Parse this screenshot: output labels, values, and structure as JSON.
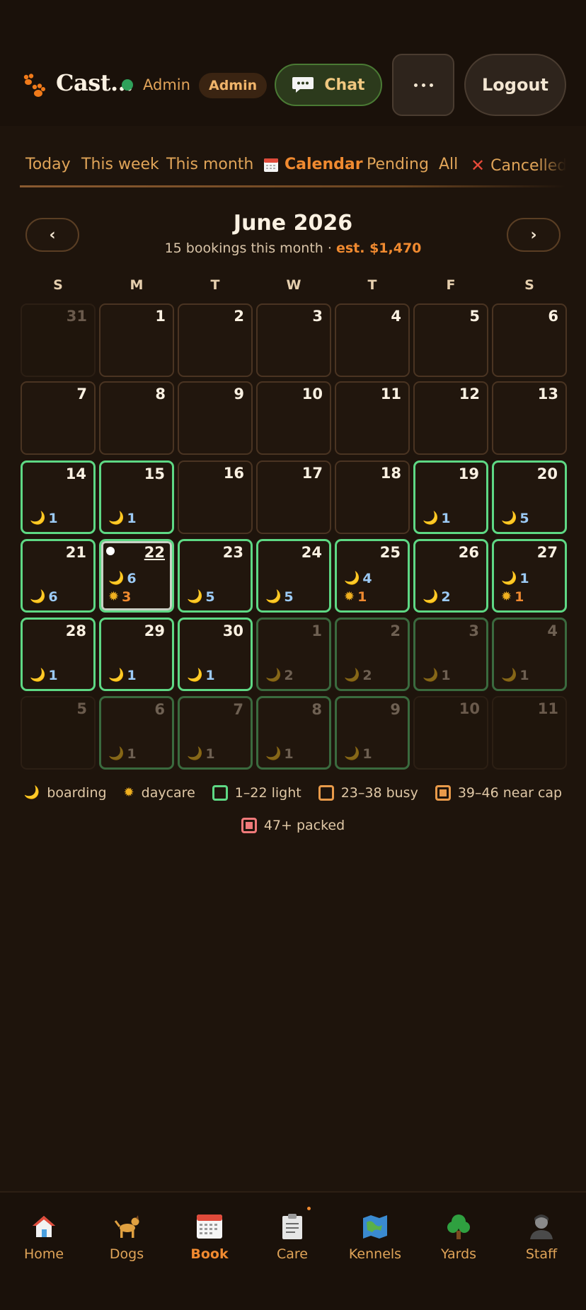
{
  "header": {
    "brand": "Cast...",
    "role_text": "Admin",
    "role_badge": "Admin",
    "chat_label": "Chat",
    "logout_label": "Logout"
  },
  "tabs": [
    {
      "label": "Today"
    },
    {
      "label": "This week"
    },
    {
      "label": "This month"
    },
    {
      "label": "Calendar",
      "active": true
    },
    {
      "label": "Pending"
    },
    {
      "label": "All"
    },
    {
      "label": "Cancelled"
    }
  ],
  "calendar": {
    "title": "June 2026",
    "subtitle": "15 bookings this month",
    "separator": "·",
    "estimate": "est. $1,470",
    "prev_label": "‹",
    "next_label": "›",
    "weekdays": [
      "S",
      "M",
      "T",
      "W",
      "T",
      "F",
      "S"
    ],
    "weeks": [
      [
        {
          "day": "31",
          "state": "outside"
        },
        {
          "day": "1",
          "state": "normal"
        },
        {
          "day": "2",
          "state": "normal"
        },
        {
          "day": "3",
          "state": "normal"
        },
        {
          "day": "4",
          "state": "normal"
        },
        {
          "day": "5",
          "state": "normal"
        },
        {
          "day": "6",
          "state": "normal"
        }
      ],
      [
        {
          "day": "7",
          "state": "normal"
        },
        {
          "day": "8",
          "state": "normal"
        },
        {
          "day": "9",
          "state": "normal"
        },
        {
          "day": "10",
          "state": "normal"
        },
        {
          "day": "11",
          "state": "normal"
        },
        {
          "day": "12",
          "state": "normal"
        },
        {
          "day": "13",
          "state": "normal"
        }
      ],
      [
        {
          "day": "14",
          "state": "light",
          "boarding": "1"
        },
        {
          "day": "15",
          "state": "light",
          "boarding": "1"
        },
        {
          "day": "16",
          "state": "normal"
        },
        {
          "day": "17",
          "state": "normal"
        },
        {
          "day": "18",
          "state": "normal"
        },
        {
          "day": "19",
          "state": "light",
          "boarding": "1"
        },
        {
          "day": "20",
          "state": "light",
          "boarding": "5"
        }
      ],
      [
        {
          "day": "21",
          "state": "light",
          "boarding": "6"
        },
        {
          "day": "22",
          "state": "today",
          "boarding": "6",
          "daycare": "3"
        },
        {
          "day": "23",
          "state": "light",
          "boarding": "5"
        },
        {
          "day": "24",
          "state": "light",
          "boarding": "5"
        },
        {
          "day": "25",
          "state": "light",
          "boarding": "4",
          "daycare": "1"
        },
        {
          "day": "26",
          "state": "light",
          "boarding": "2"
        },
        {
          "day": "27",
          "state": "light",
          "boarding": "1",
          "daycare": "1"
        }
      ],
      [
        {
          "day": "28",
          "state": "light",
          "boarding": "1"
        },
        {
          "day": "29",
          "state": "light",
          "boarding": "1"
        },
        {
          "day": "30",
          "state": "light",
          "boarding": "1"
        },
        {
          "day": "1",
          "state": "light-dim",
          "boarding": "2"
        },
        {
          "day": "2",
          "state": "light-dim",
          "boarding": "2"
        },
        {
          "day": "3",
          "state": "light-dim",
          "boarding": "1"
        },
        {
          "day": "4",
          "state": "light-dim",
          "boarding": "1"
        }
      ],
      [
        {
          "day": "5",
          "state": "outside"
        },
        {
          "day": "6",
          "state": "light-dim",
          "boarding": "1"
        },
        {
          "day": "7",
          "state": "light-dim",
          "boarding": "1"
        },
        {
          "day": "8",
          "state": "light-dim",
          "boarding": "1"
        },
        {
          "day": "9",
          "state": "light-dim",
          "boarding": "1"
        },
        {
          "day": "10",
          "state": "outside"
        },
        {
          "day": "11",
          "state": "outside"
        }
      ]
    ]
  },
  "legend": {
    "boarding": "boarding",
    "daycare": "daycare",
    "light": "1–22 light",
    "busy": "23–38 busy",
    "near_cap": "39–46 near cap",
    "packed": "47+ packed"
  },
  "colors": {
    "accent": "#f08a30",
    "light": "#5ed884",
    "busy": "#e89a4a",
    "packed": "#f07a7a",
    "boarding_count": "#9ccaf5"
  },
  "bottom_nav": [
    {
      "label": "Home",
      "icon": "home-icon"
    },
    {
      "label": "Dogs",
      "icon": "dog-icon"
    },
    {
      "label": "Book",
      "icon": "calendar-icon",
      "active": true
    },
    {
      "label": "Care",
      "icon": "clipboard-icon"
    },
    {
      "label": "Kennels",
      "icon": "map-icon"
    },
    {
      "label": "Yards",
      "icon": "tree-icon"
    },
    {
      "label": "Staff",
      "icon": "person-icon"
    }
  ]
}
